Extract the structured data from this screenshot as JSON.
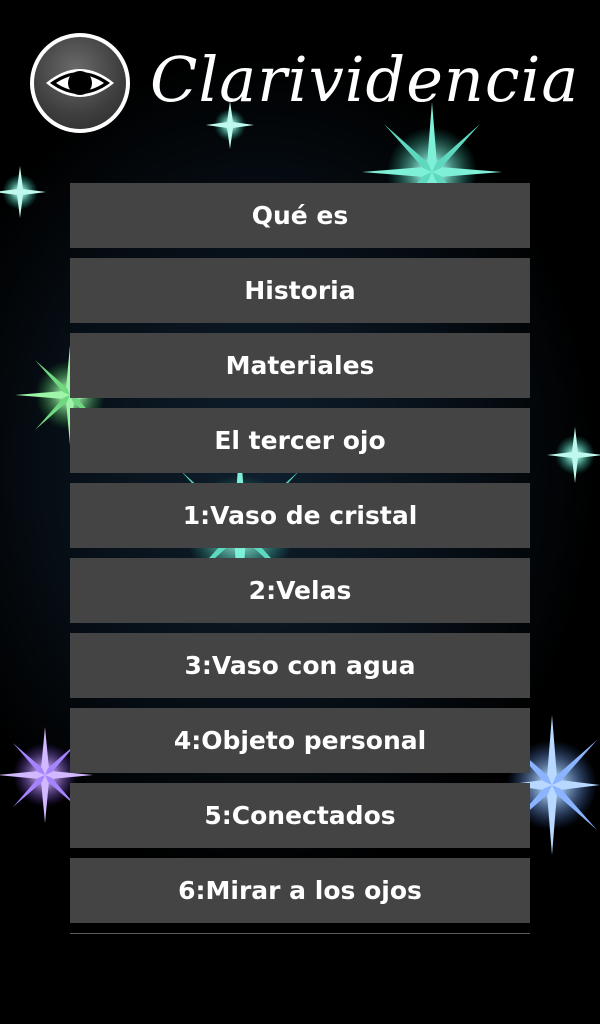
{
  "header": {
    "title": "Clarividencia",
    "logo_icon": "eye-icon"
  },
  "menu": {
    "items": [
      {
        "label": "Qué es"
      },
      {
        "label": "Historia"
      },
      {
        "label": "Materiales"
      },
      {
        "label": "El tercer ojo"
      },
      {
        "label": "1:Vaso de cristal"
      },
      {
        "label": "2:Velas"
      },
      {
        "label": "3:Vaso con agua"
      },
      {
        "label": "4:Objeto personal"
      },
      {
        "label": "5:Conectados"
      },
      {
        "label": "6:Mirar a los ojos"
      }
    ]
  },
  "colors": {
    "background": "#000000",
    "button": "#444444",
    "text": "#ffffff"
  }
}
